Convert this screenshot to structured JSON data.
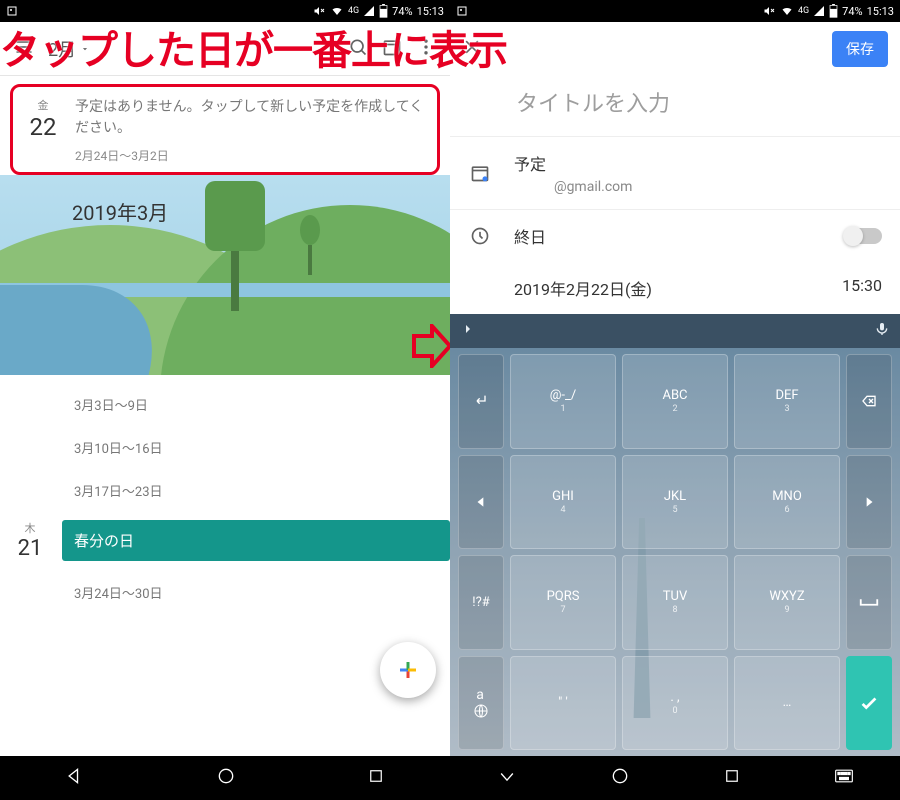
{
  "annotation": "タップした日が一番上に表示",
  "status": {
    "network": "4G",
    "battery": "74%",
    "time": "15:13"
  },
  "left": {
    "month_dropdown": "2月",
    "selected": {
      "dow": "金",
      "num": "22",
      "desc": "予定はありません。タップして新しい予定を作成してください。",
      "range": "2月24日～3月2日"
    },
    "month_header": "2019年3月",
    "weeks": [
      "3月3日～9日",
      "3月10日～16日",
      "3月17日～23日"
    ],
    "holiday": {
      "dow": "木",
      "num": "21",
      "name": "春分の日"
    },
    "later_week": "3月24日～30日"
  },
  "right": {
    "save": "保存",
    "title_placeholder": "タイトルを入力",
    "schedule": "予定",
    "account": "@gmail.com",
    "allday": "終日",
    "date": "2019年2月22日(金)",
    "time": "15:30"
  },
  "keyboard": {
    "rows": [
      [
        {
          "side": true,
          "icon": "left-hook"
        },
        {
          "label": "@-_/",
          "sub": "1"
        },
        {
          "label": "ABC",
          "sub": "2"
        },
        {
          "label": "DEF",
          "sub": "3"
        },
        {
          "side": true,
          "icon": "backspace"
        }
      ],
      [
        {
          "side": true,
          "icon": "left"
        },
        {
          "label": "GHI",
          "sub": "4"
        },
        {
          "label": "JKL",
          "sub": "5"
        },
        {
          "label": "MNO",
          "sub": "6"
        },
        {
          "side": true,
          "icon": "right"
        }
      ],
      [
        {
          "side": true,
          "label": "!?#"
        },
        {
          "label": "PQRS",
          "sub": "7"
        },
        {
          "label": "TUV",
          "sub": "8"
        },
        {
          "label": "WXYZ",
          "sub": "9"
        },
        {
          "side": true,
          "icon": "space"
        }
      ],
      [
        {
          "side": true,
          "label": "a",
          "icon": "globe"
        },
        {
          "label": "\" '",
          "sub": ""
        },
        {
          "label": ". ,",
          "sub": "0"
        },
        {
          "label": "…",
          "sub": ""
        },
        {
          "side": true,
          "enter": true,
          "icon": "check"
        }
      ]
    ]
  }
}
